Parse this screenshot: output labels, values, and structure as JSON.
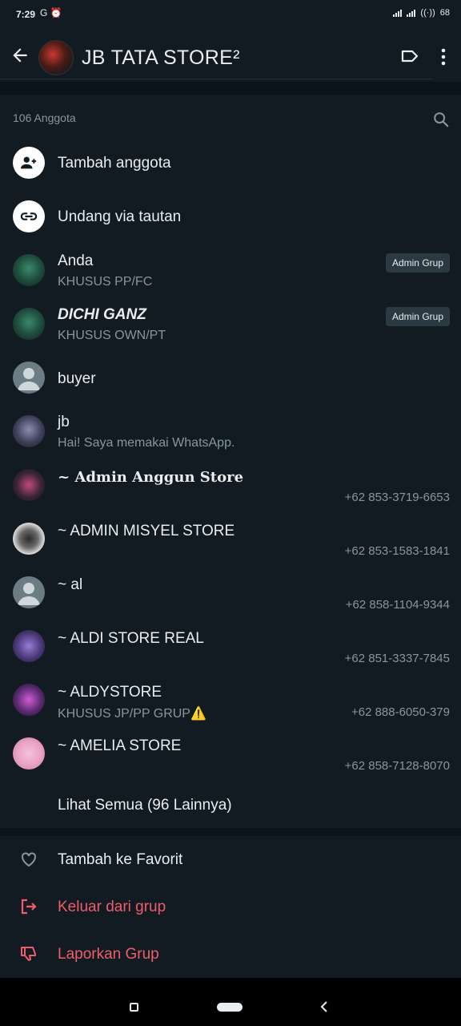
{
  "statusbar": {
    "time": "7:29",
    "left_icons": "G ⏰",
    "battery": "68"
  },
  "header": {
    "title": "JB TATA STORE²"
  },
  "members": {
    "count_label": "106 Anggota",
    "add_member": "Tambah anggota",
    "invite_link": "Undang via tautan",
    "list": [
      {
        "name": "Anda",
        "sub": "KHUSUS PP/FC",
        "badge": "Admin Grup",
        "phone": ""
      },
      {
        "name": "DICHI GANZ",
        "sub": "KHUSUS OWN/PT",
        "badge": "Admin Grup",
        "phone": ""
      },
      {
        "name": "buyer",
        "sub": "",
        "badge": "",
        "phone": ""
      },
      {
        "name": "jb",
        "sub": "Hai! Saya memakai WhatsApp.",
        "badge": "",
        "phone": ""
      },
      {
        "name": "~ 𝐀𝐝𝐦𝐢𝐧 𝐀𝐧𝐠𝐠𝐮𝐧 𝐒𝐭𝐨𝐫𝐞",
        "sub": "",
        "badge": "",
        "phone": "+62 853-3719-6653"
      },
      {
        "name": "~ ADMIN MISYEL STORE",
        "sub": "",
        "badge": "",
        "phone": "+62 853-1583-1841"
      },
      {
        "name": "~ al",
        "sub": "",
        "badge": "",
        "phone": "+62 858-1104-9344"
      },
      {
        "name": "~ ALDI STORE REAL",
        "sub": "",
        "badge": "",
        "phone": "+62 851-3337-7845"
      },
      {
        "name": "~ ALDYSTORE",
        "sub": "KHUSUS JP/PP GRUP⚠️",
        "badge": "",
        "phone": "+62 888-6050-379"
      },
      {
        "name": "~ AMELIA STORE",
        "sub": "",
        "badge": "",
        "phone": "+62 858-7128-8070"
      }
    ],
    "see_all": "Lihat Semua (96 Lainnya)"
  },
  "actions": {
    "favorite": "Tambah ke Favorit",
    "exit": "Keluar dari grup",
    "report": "Laporkan Grup"
  },
  "colors": {
    "background": "#0b141a",
    "surface": "#111b21",
    "danger": "#f15c6d",
    "muted": "#8696a0"
  }
}
